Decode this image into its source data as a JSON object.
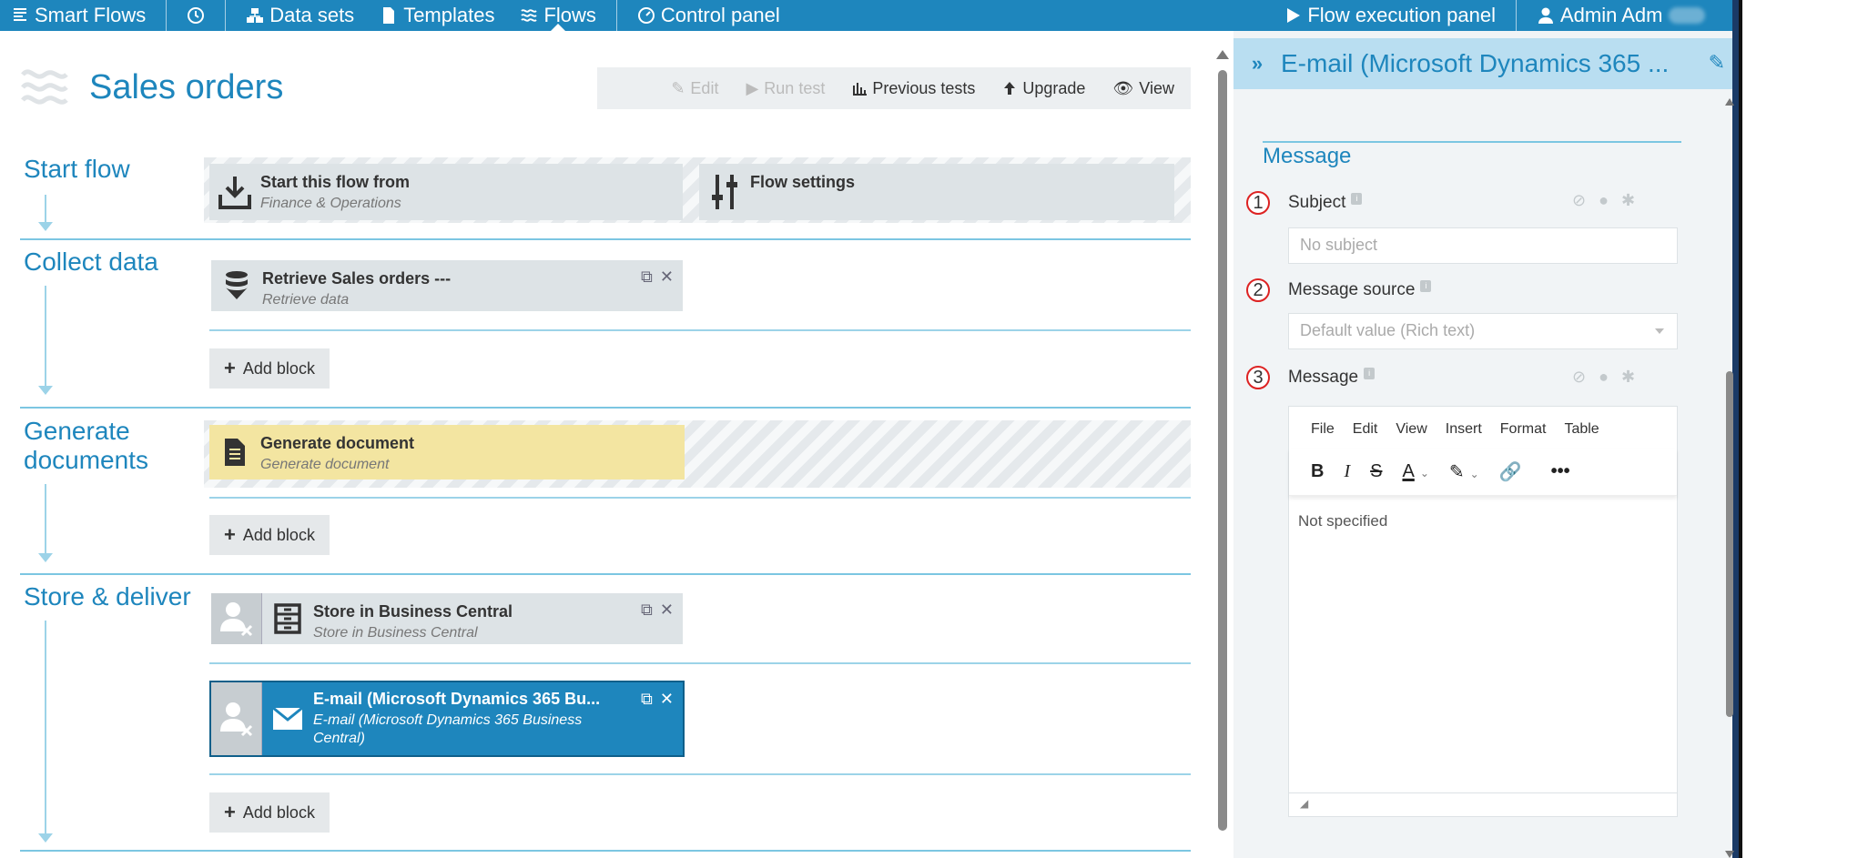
{
  "nav": {
    "brand": "Smart Flows",
    "datasets": "Data sets",
    "templates": "Templates",
    "flows": "Flows",
    "control_panel": "Control panel",
    "flow_execution": "Flow execution panel",
    "user": "Admin Adm"
  },
  "page": {
    "title": "Sales orders",
    "toolbar": {
      "edit": "Edit",
      "run_test": "Run test",
      "previous_tests": "Previous tests",
      "upgrade": "Upgrade",
      "view": "View"
    }
  },
  "sections": {
    "start": {
      "title": "Start flow",
      "block1_title": "Start this flow from",
      "block1_sub": "Finance & Operations",
      "block2_title": "Flow settings"
    },
    "collect": {
      "title": "Collect data",
      "block_title": "Retrieve Sales orders ---",
      "block_sub": "Retrieve data",
      "add": "Add block"
    },
    "generate": {
      "title_line1": "Generate",
      "title_line2": "documents",
      "block_title": "Generate document",
      "block_sub": "Generate document",
      "add": "Add block"
    },
    "store": {
      "title": "Store & deliver",
      "block1_title": "Store in Business Central",
      "block1_sub": "Store in Business Central",
      "block2_title": "E-mail (Microsoft Dynamics 365 Bu...",
      "block2_sub_line1": "E-mail (Microsoft Dynamics 365 Business",
      "block2_sub_line2": "Central)",
      "add": "Add block"
    }
  },
  "panel": {
    "title": "E-mail (Microsoft Dynamics 365 ...",
    "section": "Message",
    "fields": {
      "subject_num": "1",
      "subject_label": "Subject",
      "subject_placeholder": "No subject",
      "source_num": "2",
      "source_label": "Message source",
      "source_value": "Default value (Rich text)",
      "message_num": "3",
      "message_label": "Message"
    },
    "editor": {
      "menu": [
        "File",
        "Edit",
        "View",
        "Insert",
        "Format",
        "Table"
      ],
      "content": "Not specified"
    }
  },
  "colors": {
    "brand": "#1e86bd",
    "selected_block": "#1e86bd",
    "generate_block": "#f3e5a1",
    "annotation": "#dd2222"
  }
}
